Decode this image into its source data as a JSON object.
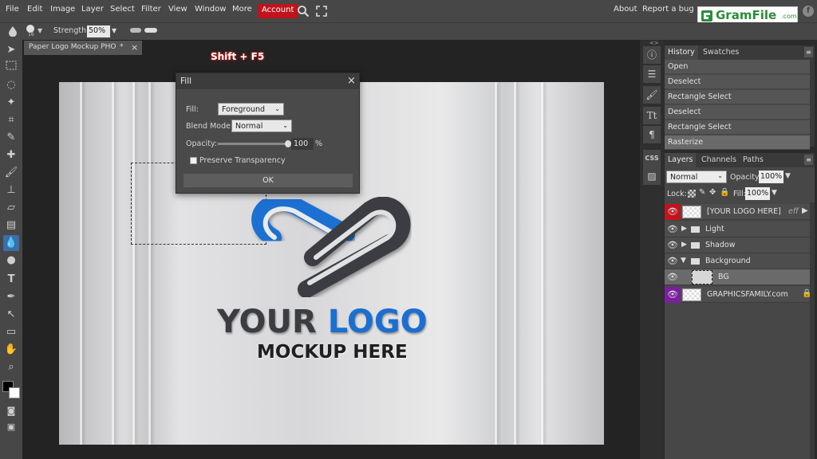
{
  "menu": {
    "items": [
      "File",
      "Edit",
      "Image",
      "Layer",
      "Select",
      "Filter",
      "View",
      "Window",
      "More"
    ],
    "account": "Account",
    "right_items": [
      "About",
      "Report a bug"
    ]
  },
  "watermark": {
    "name": "GramFile",
    "suffix": ".com"
  },
  "options": {
    "strength_label": "Strength:",
    "strength_value": "50%",
    "brush_size": "16"
  },
  "annotation": {
    "shortcut": "Shift + F5"
  },
  "document": {
    "tab_title": "Paper Logo Mockup PHO",
    "tab_modified": "*",
    "tab_close": "×"
  },
  "logo": {
    "line1_a": "YOUR ",
    "line1_b": "LOGO",
    "line2": "MOCKUP HERE"
  },
  "fill_dialog": {
    "title": "Fill",
    "close": "×",
    "fill_label": "Fill:",
    "fill_value": "Foreground",
    "blend_label": "Blend Mode:",
    "blend_value": "Normal",
    "opacity_label": "Opacity:",
    "opacity_value": "100",
    "opacity_unit": "%",
    "opacity_level": 1.0,
    "preserve_label": "Preserve Transparency",
    "preserve_checked": false,
    "ok_label": "OK"
  },
  "history_panel": {
    "tabs": [
      "History",
      "Swatches"
    ],
    "items": [
      "Open",
      "Deselect",
      "Rectangle Select",
      "Deselect",
      "Rectangle Select",
      "Rasterize"
    ]
  },
  "layers_panel": {
    "tabs": [
      "Layers",
      "Channels",
      "Paths"
    ],
    "blend_mode": "Normal",
    "opacity_label": "Opacity:",
    "opacity_value": "100%",
    "lock_label": "Lock:",
    "fill_label": "Fill:",
    "fill_value": "100%",
    "layers": [
      {
        "name": "[YOUR LOGO HERE]",
        "suffix": "eff",
        "kind": "smart"
      },
      {
        "name": "Light",
        "kind": "folder"
      },
      {
        "name": "Shadow",
        "kind": "folder"
      },
      {
        "name": "Background",
        "kind": "folder-open"
      },
      {
        "name": "BG",
        "kind": "layer"
      },
      {
        "name": "GRAPHICSFAMILY.com",
        "kind": "locked"
      }
    ]
  },
  "right_icons": {
    "css": "CSS",
    "text": "Tt",
    "paragraph": "¶"
  },
  "colors": {
    "accent_red": "#c0141c",
    "logo_blue": "#1a6fd1",
    "logo_dark": "#3a3d42",
    "purple": "#7a1fa0"
  }
}
